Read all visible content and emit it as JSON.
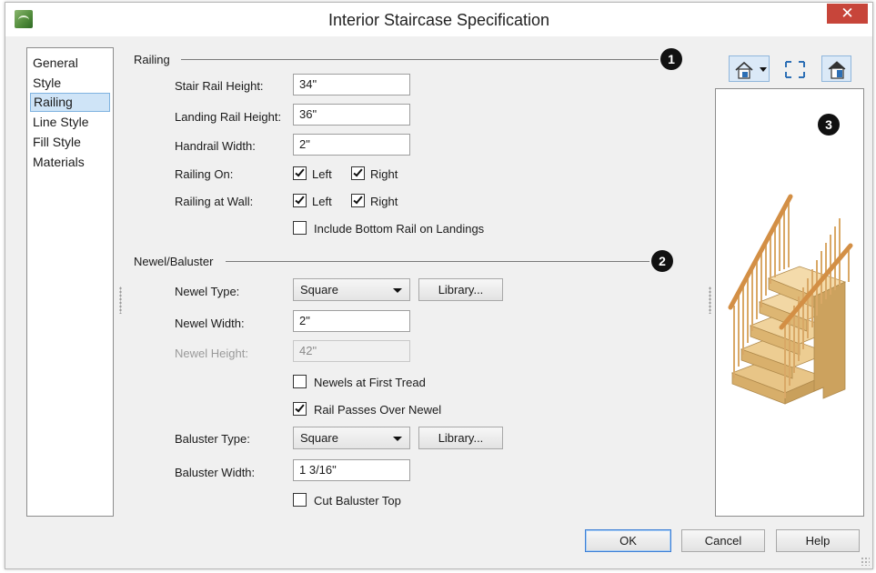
{
  "window": {
    "title": "Interior Staircase Specification",
    "close_glyph": "✕"
  },
  "nav": {
    "items": [
      "General",
      "Style",
      "Railing",
      "Line Style",
      "Fill Style",
      "Materials"
    ],
    "selected": "Railing"
  },
  "railing": {
    "section_label": "Railing",
    "callout": "1",
    "stair_rail_height_label": "Stair Rail Height:",
    "stair_rail_height_value": "34\"",
    "landing_rail_height_label": "Landing Rail Height:",
    "landing_rail_height_value": "36\"",
    "handrail_width_label": "Handrail Width:",
    "handrail_width_value": "2\"",
    "railing_on_label": "Railing On:",
    "railing_on_left_label": "Left",
    "railing_on_left_checked": true,
    "railing_on_right_label": "Right",
    "railing_on_right_checked": true,
    "railing_at_wall_label": "Railing at Wall:",
    "railing_at_wall_left_label": "Left",
    "railing_at_wall_left_checked": true,
    "railing_at_wall_right_label": "Right",
    "railing_at_wall_right_checked": true,
    "bottom_rail_label": "Include Bottom Rail on Landings",
    "bottom_rail_checked": false
  },
  "newel": {
    "section_label": "Newel/Baluster",
    "callout": "2",
    "newel_type_label": "Newel Type:",
    "newel_type_value": "Square",
    "library_label": "Library...",
    "newel_width_label": "Newel Width:",
    "newel_width_value": "2\"",
    "newel_height_label": "Newel Height:",
    "newel_height_value": "42\"",
    "newels_first_tread_label": "Newels at First Tread",
    "newels_first_tread_checked": false,
    "rail_passes_over_label": "Rail Passes Over Newel",
    "rail_passes_over_checked": true,
    "baluster_type_label": "Baluster Type:",
    "baluster_type_value": "Square",
    "baluster_library_label": "Library...",
    "baluster_width_label": "Baluster Width:",
    "baluster_width_value": "1 3/16\"",
    "cut_baluster_top_label": "Cut Baluster Top",
    "cut_baluster_top_checked": false
  },
  "preview": {
    "callout": "3",
    "tools": [
      "view-mode-icon",
      "fill-window-icon",
      "display-options-icon"
    ]
  },
  "footer": {
    "ok_label": "OK",
    "cancel_label": "Cancel",
    "help_label": "Help"
  },
  "colors": {
    "selection": "#cfe4f7",
    "close_button": "#c7453a",
    "wood": "#e0b878"
  }
}
